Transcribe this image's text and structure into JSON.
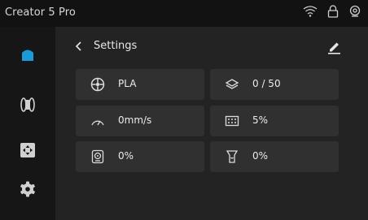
{
  "app": {
    "title": "Creator 5 Pro"
  },
  "status_icons": [
    "wifi-icon",
    "lock-icon",
    "camera-icon"
  ],
  "sidebar": {
    "items": [
      {
        "name": "home",
        "icon": "home-icon",
        "active": true
      },
      {
        "name": "filament",
        "icon": "filament-spool-icon",
        "active": false
      },
      {
        "name": "move",
        "icon": "move-axis-icon",
        "active": false
      },
      {
        "name": "settings",
        "icon": "gear-icon",
        "active": false
      }
    ]
  },
  "header": {
    "title": "Settings"
  },
  "tiles": [
    {
      "name": "filament-material",
      "icon": "filament-spool-icon",
      "value": "PLA"
    },
    {
      "name": "layer-count",
      "icon": "layers-icon",
      "value": "0 / 50"
    },
    {
      "name": "print-speed",
      "icon": "speedometer-icon",
      "value": "0mm/s"
    },
    {
      "name": "infill",
      "icon": "infill-grid-icon",
      "value": "5%"
    },
    {
      "name": "fan-speed",
      "icon": "fan-icon",
      "value": "0%"
    },
    {
      "name": "flow-rate",
      "icon": "extruder-flow-icon",
      "value": "0%"
    }
  ],
  "colors": {
    "accent": "#1a9bd7",
    "background": "#232323",
    "tile": "#303030",
    "sidebar": "#161616"
  }
}
